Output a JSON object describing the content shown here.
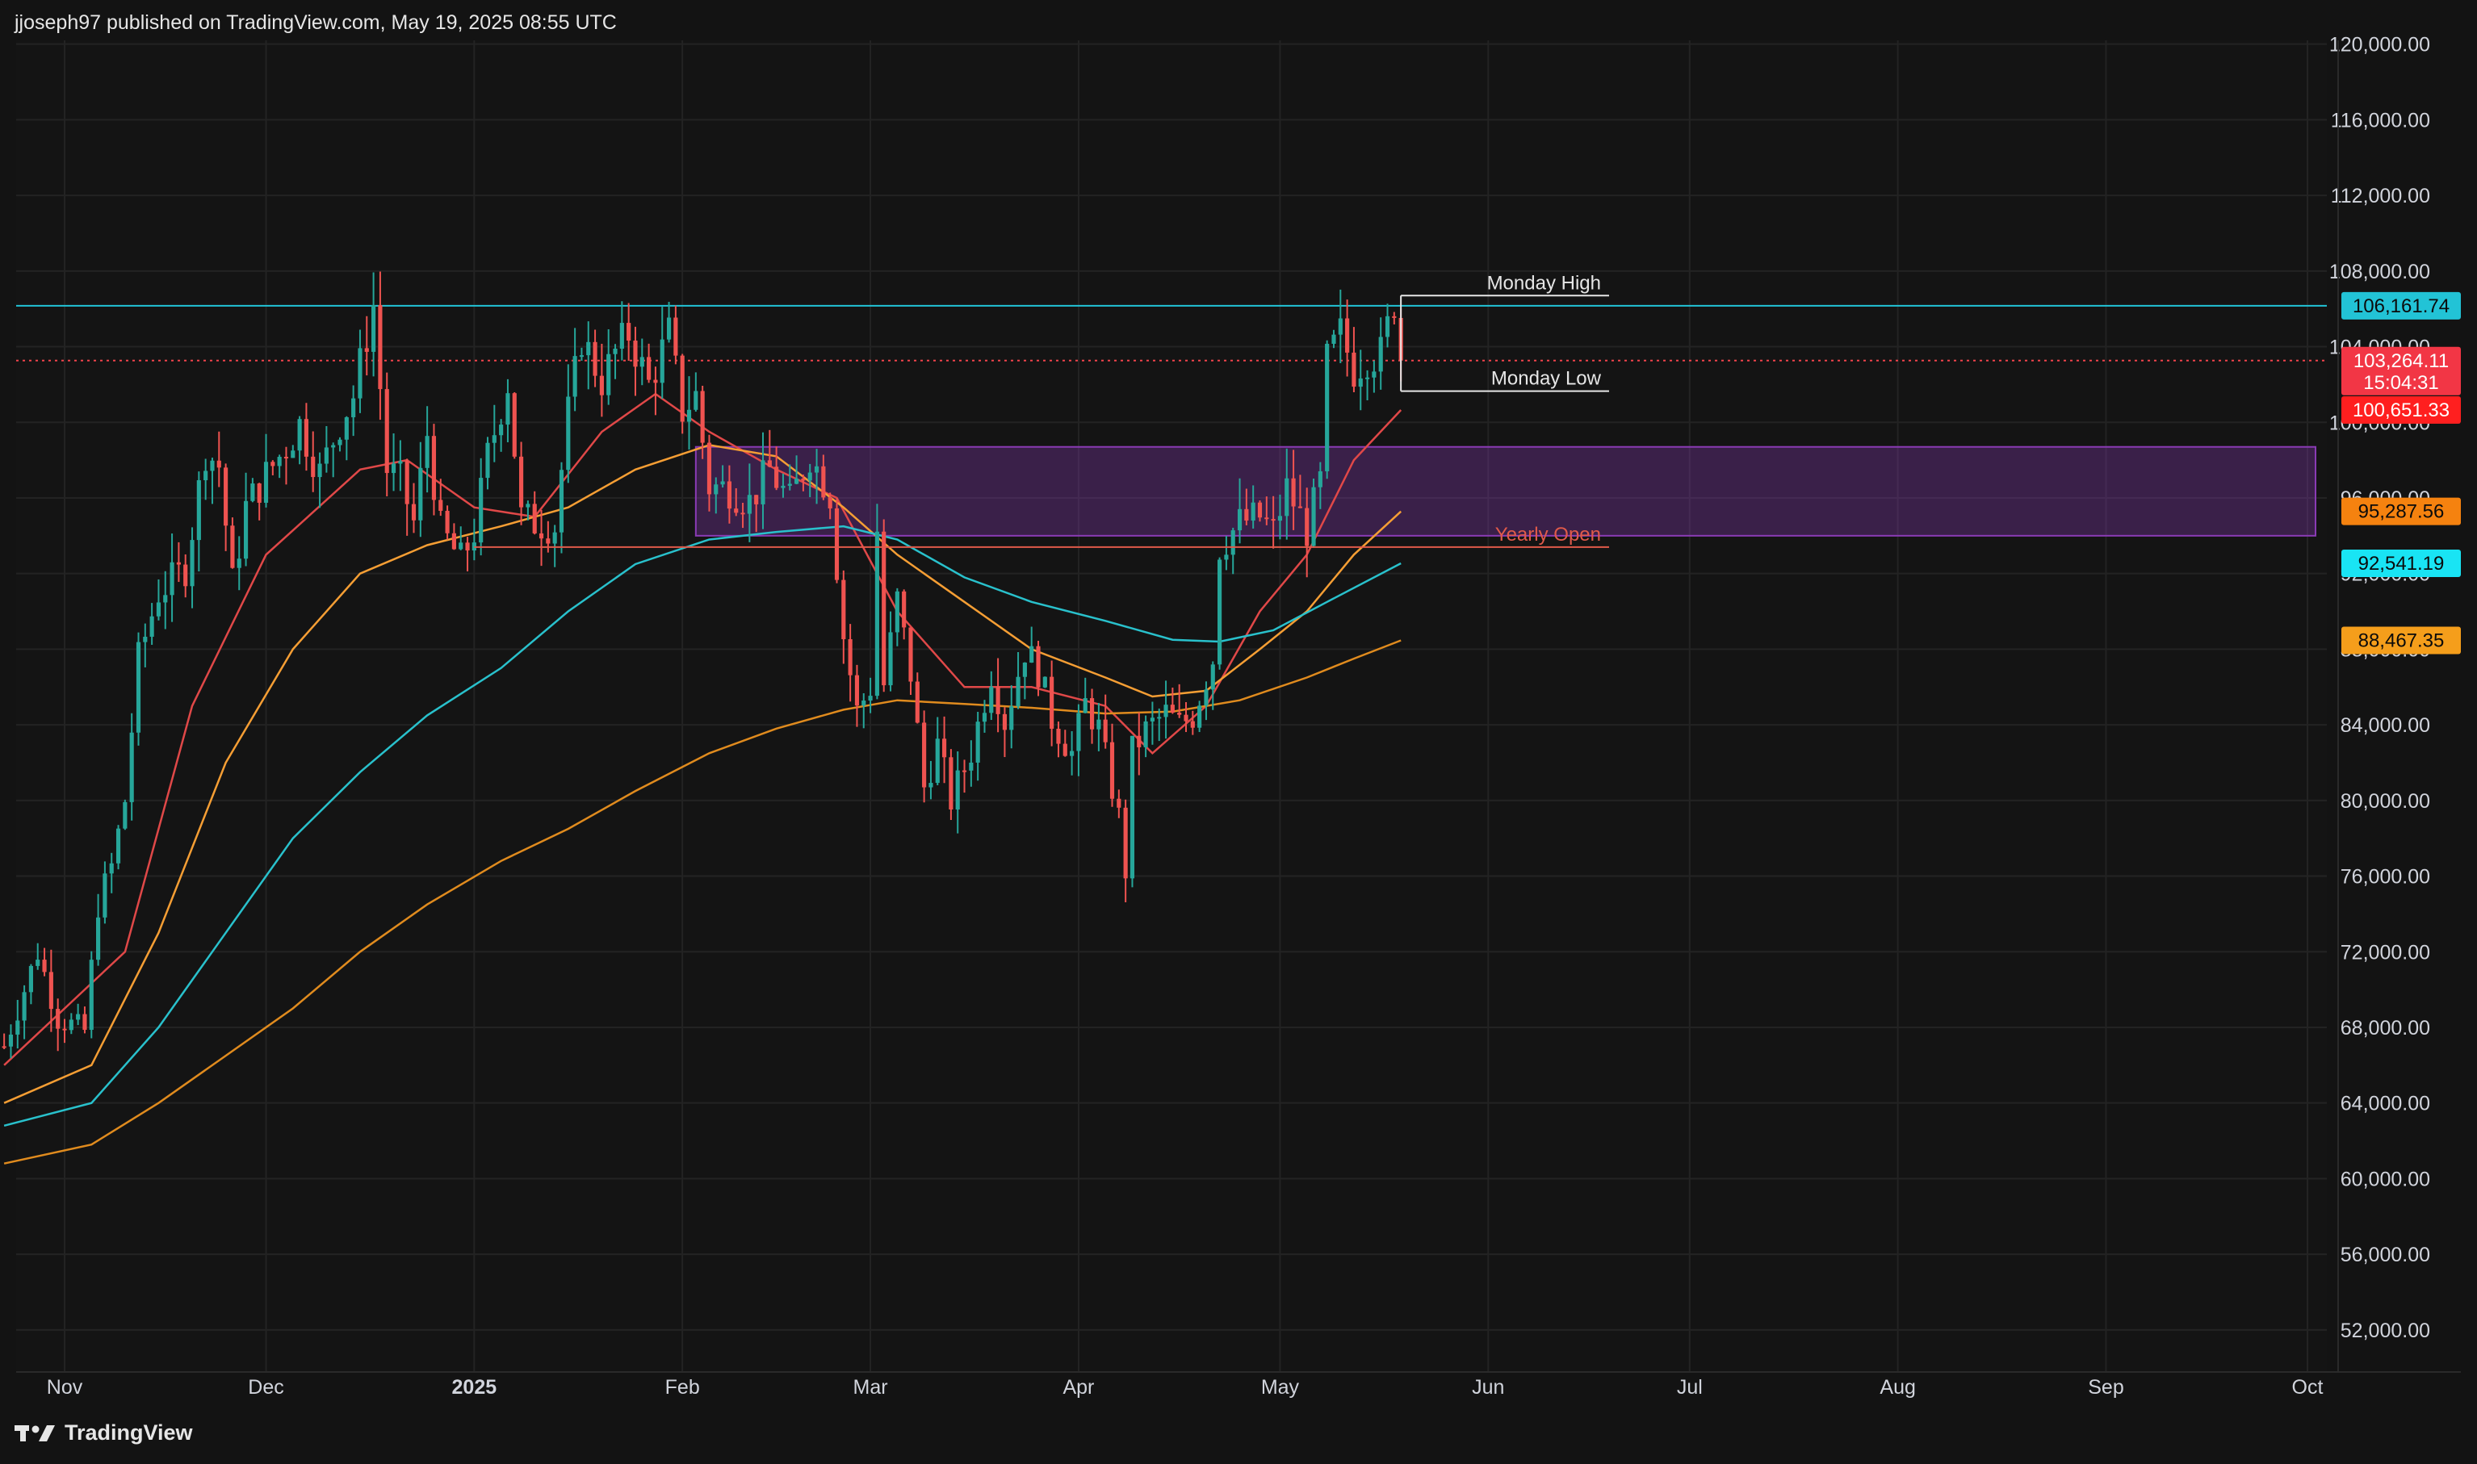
{
  "header": {
    "text": "jjoseph97 published on TradingView.com, May 19, 2025 08:55 UTC"
  },
  "footer": {
    "brand": "TradingView",
    "logo_icon": "tradingview-logo-icon"
  },
  "chart_data": {
    "type": "candlestick",
    "symbol_timeframe": "1D",
    "x_time_labels": [
      {
        "label": "Nov",
        "date": "2024-11-01",
        "bold": false
      },
      {
        "label": "Dec",
        "date": "2024-12-01",
        "bold": false
      },
      {
        "label": "2025",
        "date": "2025-01-01",
        "bold": true
      },
      {
        "label": "Feb",
        "date": "2025-02-01",
        "bold": false
      },
      {
        "label": "Mar",
        "date": "2025-03-01",
        "bold": false
      },
      {
        "label": "Apr",
        "date": "2025-04-01",
        "bold": false
      },
      {
        "label": "May",
        "date": "2025-05-01",
        "bold": false
      },
      {
        "label": "Jun",
        "date": "2025-06-01",
        "bold": false
      },
      {
        "label": "Jul",
        "date": "2025-07-01",
        "bold": false
      },
      {
        "label": "Aug",
        "date": "2025-08-01",
        "bold": false
      },
      {
        "label": "Sep",
        "date": "2025-09-01",
        "bold": false
      },
      {
        "label": "Oct",
        "date": "2025-10-01",
        "bold": false
      }
    ],
    "y_ticks": [
      52000,
      56000,
      60000,
      64000,
      68000,
      72000,
      76000,
      80000,
      84000,
      88000,
      92000,
      96000,
      100000,
      104000,
      108000,
      112000,
      116000,
      120000
    ],
    "y_tick_labels": [
      "52,000.00",
      "56,000.00",
      "60,000.00",
      "64,000.00",
      "68,000.00",
      "72,000.00",
      "76,000.00",
      "80,000.00",
      "84,000.00",
      "88,000.00",
      "92,000.00",
      "96,000.00",
      "100,000.00",
      "104,000.00",
      "108,000.00",
      "112,000.00",
      "116,000.00",
      "120,000.00"
    ],
    "ylim": [
      50200,
      120200
    ],
    "grid": true,
    "colors": {
      "up": "#26a69a",
      "down": "#ef5350",
      "background": "#131313",
      "grid": "#232323"
    },
    "price_path_closes": [
      [
        "2024-10-23",
        67000
      ],
      [
        "2024-10-28",
        72000
      ],
      [
        "2024-10-31",
        68500
      ],
      [
        "2024-11-04",
        67800
      ],
      [
        "2024-11-06",
        74500
      ],
      [
        "2024-11-08",
        76500
      ],
      [
        "2024-11-10",
        80000
      ],
      [
        "2024-11-12",
        87500
      ],
      [
        "2024-11-15",
        91000
      ],
      [
        "2024-11-19",
        92300
      ],
      [
        "2024-11-22",
        98500
      ],
      [
        "2024-11-24",
        97700
      ],
      [
        "2024-11-26",
        91500
      ],
      [
        "2024-11-28",
        95500
      ],
      [
        "2024-12-01",
        97200
      ],
      [
        "2024-12-04",
        98700
      ],
      [
        "2024-12-06",
        99900
      ],
      [
        "2024-12-09",
        97300
      ],
      [
        "2024-12-12",
        100000
      ],
      [
        "2024-12-14",
        101400
      ],
      [
        "2024-12-17",
        106200
      ],
      [
        "2024-12-19",
        97500
      ],
      [
        "2024-12-21",
        96900
      ],
      [
        "2024-12-23",
        94700
      ],
      [
        "2024-12-25",
        99400
      ],
      [
        "2024-12-27",
        94300
      ],
      [
        "2024-12-30",
        92700
      ],
      [
        "2025-01-01",
        94200
      ],
      [
        "2025-01-03",
        98200
      ],
      [
        "2025-01-06",
        102100
      ],
      [
        "2025-01-08",
        95000
      ],
      [
        "2025-01-10",
        94700
      ],
      [
        "2025-01-13",
        94500
      ],
      [
        "2025-01-15",
        100500
      ],
      [
        "2025-01-17",
        104500
      ],
      [
        "2025-01-20",
        102200
      ],
      [
        "2025-01-22",
        103700
      ],
      [
        "2025-01-24",
        104700
      ],
      [
        "2025-01-27",
        102000
      ],
      [
        "2025-01-30",
        104700
      ],
      [
        "2025-02-01",
        100600
      ],
      [
        "2025-02-03",
        101400
      ],
      [
        "2025-02-05",
        96600
      ],
      [
        "2025-02-08",
        96500
      ],
      [
        "2025-02-11",
        95800
      ],
      [
        "2025-02-14",
        97500
      ],
      [
        "2025-02-17",
        95800
      ],
      [
        "2025-02-20",
        98300
      ],
      [
        "2025-02-23",
        96200
      ],
      [
        "2025-02-25",
        88700
      ],
      [
        "2025-02-27",
        84700
      ],
      [
        "2025-03-01",
        86000
      ],
      [
        "2025-03-02",
        94300
      ],
      [
        "2025-03-03",
        86100
      ],
      [
        "2025-03-05",
        90600
      ],
      [
        "2025-03-07",
        86700
      ],
      [
        "2025-03-09",
        80700
      ],
      [
        "2025-03-11",
        82900
      ],
      [
        "2025-03-13",
        80000
      ],
      [
        "2025-03-16",
        82600
      ],
      [
        "2025-03-19",
        86800
      ],
      [
        "2025-03-21",
        84200
      ],
      [
        "2025-03-24",
        88000
      ],
      [
        "2025-03-26",
        86900
      ],
      [
        "2025-03-28",
        84300
      ],
      [
        "2025-03-31",
        82500
      ],
      [
        "2025-04-02",
        85100
      ],
      [
        "2025-04-04",
        83800
      ],
      [
        "2025-04-07",
        79100
      ],
      [
        "2025-04-08",
        76300
      ],
      [
        "2025-04-09",
        82600
      ],
      [
        "2025-04-11",
        83700
      ],
      [
        "2025-04-14",
        84600
      ],
      [
        "2025-04-16",
        84000
      ],
      [
        "2025-04-18",
        84500
      ],
      [
        "2025-04-21",
        87500
      ],
      [
        "2025-04-22",
        93400
      ],
      [
        "2025-04-25",
        94700
      ],
      [
        "2025-04-28",
        95000
      ],
      [
        "2025-04-30",
        94200
      ],
      [
        "2025-05-02",
        96500
      ],
      [
        "2025-05-05",
        94300
      ],
      [
        "2025-05-07",
        96800
      ],
      [
        "2025-05-08",
        103200
      ],
      [
        "2025-05-10",
        104700
      ],
      [
        "2025-05-12",
        102800
      ],
      [
        "2025-05-14",
        103500
      ],
      [
        "2025-05-16",
        103600
      ],
      [
        "2025-05-18",
        106400
      ],
      [
        "2025-05-19",
        103264.11
      ]
    ],
    "moving_averages": [
      {
        "color": "#e04848",
        "points": [
          [
            "2024-10-23",
            66000
          ],
          [
            "2024-11-10",
            72000
          ],
          [
            "2024-11-20",
            85000
          ],
          [
            "2024-12-01",
            93000
          ],
          [
            "2024-12-15",
            97500
          ],
          [
            "2024-12-22",
            98000
          ],
          [
            "2025-01-01",
            95500
          ],
          [
            "2025-01-10",
            95000
          ],
          [
            "2025-01-20",
            99500
          ],
          [
            "2025-01-28",
            101500
          ],
          [
            "2025-02-05",
            99500
          ],
          [
            "2025-02-15",
            97500
          ],
          [
            "2025-02-24",
            96000
          ],
          [
            "2025-03-05",
            90000
          ],
          [
            "2025-03-15",
            86000
          ],
          [
            "2025-03-25",
            86000
          ],
          [
            "2025-04-05",
            85000
          ],
          [
            "2025-04-12",
            82500
          ],
          [
            "2025-04-20",
            85000
          ],
          [
            "2025-04-28",
            90000
          ],
          [
            "2025-05-05",
            93000
          ],
          [
            "2025-05-12",
            98000
          ],
          [
            "2025-05-19",
            100651.33
          ]
        ]
      },
      {
        "color": "#f59e34",
        "points": [
          [
            "2024-10-23",
            64000
          ],
          [
            "2024-11-05",
            66000
          ],
          [
            "2024-11-15",
            73000
          ],
          [
            "2024-11-25",
            82000
          ],
          [
            "2024-12-05",
            88000
          ],
          [
            "2024-12-15",
            92000
          ],
          [
            "2024-12-25",
            93500
          ],
          [
            "2025-01-05",
            94500
          ],
          [
            "2025-01-15",
            95500
          ],
          [
            "2025-01-25",
            97500
          ],
          [
            "2025-02-05",
            98800
          ],
          [
            "2025-02-15",
            98200
          ],
          [
            "2025-02-25",
            95500
          ],
          [
            "2025-03-05",
            93000
          ],
          [
            "2025-03-15",
            90500
          ],
          [
            "2025-03-25",
            88000
          ],
          [
            "2025-04-05",
            86500
          ],
          [
            "2025-04-12",
            85500
          ],
          [
            "2025-04-20",
            85800
          ],
          [
            "2025-04-28",
            88000
          ],
          [
            "2025-05-05",
            90000
          ],
          [
            "2025-05-12",
            93000
          ],
          [
            "2025-05-19",
            95287.56
          ]
        ]
      },
      {
        "color": "#29c1cc",
        "points": [
          [
            "2024-10-23",
            62800
          ],
          [
            "2024-11-05",
            64000
          ],
          [
            "2024-11-15",
            68000
          ],
          [
            "2024-11-25",
            73000
          ],
          [
            "2024-12-05",
            78000
          ],
          [
            "2024-12-15",
            81500
          ],
          [
            "2024-12-25",
            84500
          ],
          [
            "2025-01-05",
            87000
          ],
          [
            "2025-01-15",
            90000
          ],
          [
            "2025-01-25",
            92500
          ],
          [
            "2025-02-05",
            93800
          ],
          [
            "2025-02-15",
            94200
          ],
          [
            "2025-02-25",
            94500
          ],
          [
            "2025-03-05",
            93800
          ],
          [
            "2025-03-15",
            91800
          ],
          [
            "2025-03-25",
            90500
          ],
          [
            "2025-04-05",
            89500
          ],
          [
            "2025-04-15",
            88500
          ],
          [
            "2025-04-22",
            88400
          ],
          [
            "2025-04-30",
            89000
          ],
          [
            "2025-05-08",
            90500
          ],
          [
            "2025-05-19",
            92541.19
          ]
        ]
      },
      {
        "color": "#e08b1e",
        "points": [
          [
            "2024-10-23",
            60800
          ],
          [
            "2024-11-05",
            61800
          ],
          [
            "2024-11-15",
            64000
          ],
          [
            "2024-11-25",
            66500
          ],
          [
            "2024-12-05",
            69000
          ],
          [
            "2024-12-15",
            72000
          ],
          [
            "2024-12-25",
            74500
          ],
          [
            "2025-01-05",
            76800
          ],
          [
            "2025-01-15",
            78500
          ],
          [
            "2025-01-25",
            80500
          ],
          [
            "2025-02-05",
            82500
          ],
          [
            "2025-02-15",
            83800
          ],
          [
            "2025-02-25",
            84800
          ],
          [
            "2025-03-05",
            85300
          ],
          [
            "2025-03-15",
            85100
          ],
          [
            "2025-03-25",
            84900
          ],
          [
            "2025-04-05",
            84600
          ],
          [
            "2025-04-15",
            84700
          ],
          [
            "2025-04-25",
            85300
          ],
          [
            "2025-05-05",
            86500
          ],
          [
            "2025-05-12",
            87500
          ],
          [
            "2025-05-19",
            88467.35
          ]
        ]
      }
    ],
    "zone": {
      "color": "#8a3bb5",
      "from_date": "2025-02-03",
      "to_date": "2025-10-01",
      "top": 98700,
      "bottom": 94000
    },
    "horizontal_lines": [
      {
        "price": 106161.74,
        "color": "#22c3d6",
        "from_date": "2024-10-23",
        "to_date": "2025-10-01",
        "style": "solid"
      },
      {
        "price": 103264.11,
        "color": "#f0434b",
        "from_date": "2024-10-23",
        "to_date": "2025-10-01",
        "style": "dotted"
      }
    ],
    "annotations": [
      {
        "label": "Monday High",
        "price": 106700,
        "from_date": "2025-05-19",
        "to_date": "2025-06-19",
        "color": "#e6e6e6"
      },
      {
        "label": "Monday Low",
        "price": 101650,
        "from_date": "2025-05-19",
        "to_date": "2025-06-19",
        "color": "#e6e6e6"
      },
      {
        "label": "Yearly Open",
        "price": 93400,
        "from_date": "2025-01-01",
        "to_date": "2025-06-19",
        "color": "#e05a4a"
      }
    ],
    "price_badges": [
      {
        "value": "106,161.74",
        "price": 106161.74,
        "bg": "#22c3d6",
        "fg": "#0b0b0b"
      },
      {
        "value": "103,264.11",
        "price": 103264.11,
        "bg": "#f23645",
        "fg": "#ffffff",
        "countdown": "15:04:31"
      },
      {
        "value": "100,651.33",
        "price": 100651.33,
        "bg": "#ff1f1f",
        "fg": "#ffffff"
      },
      {
        "value": "95,287.56",
        "price": 95287.56,
        "bg": "#f5820f",
        "fg": "#0b0b0b"
      },
      {
        "value": "92,541.19",
        "price": 92541.19,
        "bg": "#19e4f4",
        "fg": "#0b0b0b"
      },
      {
        "value": "88,467.35",
        "price": 88467.35,
        "bg": "#f59e1b",
        "fg": "#0b0b0b"
      }
    ]
  }
}
